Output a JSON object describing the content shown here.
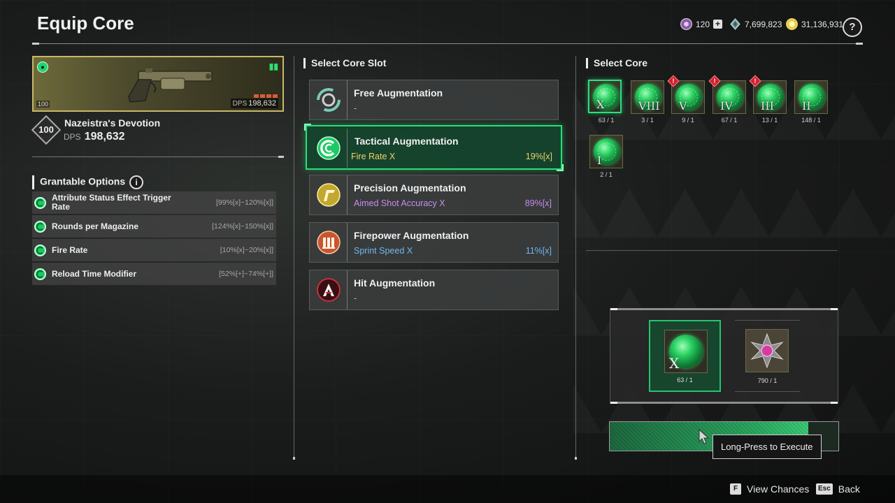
{
  "screen": {
    "title": "Equip Core"
  },
  "currencies": [
    {
      "icon": "shard-icon",
      "value": "120",
      "color": "#b48acb"
    },
    {
      "icon": "crystal-icon",
      "value": "7,699,823",
      "color": "#7fa6a6"
    },
    {
      "icon": "gold-coin-icon",
      "value": "31,136,931",
      "color": "#e6cf58"
    }
  ],
  "help": {
    "label": "?"
  },
  "weapon": {
    "level_badge": "100",
    "card_dps_label": "DPS",
    "card_dps": "198,632",
    "name": "Nazeistra's Devotion",
    "level": "100",
    "dps_label": "DPS",
    "dps": "198,632",
    "ammo_icon": "ammo-icon",
    "rarity_color": "#c8b86a"
  },
  "grantable": {
    "title": "Grantable Options",
    "info": "i",
    "options": [
      {
        "name": "Attribute Status Effect Trigger Rate",
        "range": "[99%[x]~120%[x]]"
      },
      {
        "name": "Rounds per Magazine",
        "range": "[124%[x]~150%[x]]"
      },
      {
        "name": "Fire Rate",
        "range": "[10%[x]~20%[x]]"
      },
      {
        "name": "Reload Time Modifier",
        "range": "[52%[+]~74%[+]]"
      }
    ]
  },
  "slots": {
    "title": "Select Core Slot",
    "items": [
      {
        "name": "Free Augmentation",
        "option": "-",
        "value": "",
        "icon": "free-augmentation-icon",
        "option_color": "#bdbdbd"
      },
      {
        "name": "Tactical Augmentation",
        "option": "Fire Rate X",
        "value": "19%[x]",
        "icon": "tactical-augmentation-icon",
        "option_color": "#e9d46a"
      },
      {
        "name": "Precision Augmentation",
        "option": "Aimed Shot Accuracy X",
        "value": "89%[x]",
        "icon": "precision-augmentation-icon",
        "option_color": "#c68cf2"
      },
      {
        "name": "Firepower Augmentation",
        "option": "Sprint Speed X",
        "value": "11%[x]",
        "icon": "firepower-augmentation-icon",
        "option_color": "#6fb7f0"
      },
      {
        "name": "Hit Augmentation",
        "option": "-",
        "value": "",
        "icon": "hit-augmentation-icon",
        "option_color": "#bdbdbd"
      }
    ]
  },
  "cores": {
    "title": "Select Core",
    "items": [
      {
        "roman": "X",
        "count": "63 / 1",
        "warn": false
      },
      {
        "roman": "VIII",
        "count": "3 / 1",
        "warn": false
      },
      {
        "roman": "V",
        "count": "9 / 1",
        "warn": true
      },
      {
        "roman": "IV",
        "count": "67 / 1",
        "warn": true
      },
      {
        "roman": "III",
        "count": "13 / 1",
        "warn": true
      },
      {
        "roman": "II",
        "count": "148 / 1",
        "warn": false
      },
      {
        "roman": "I",
        "count": "2 / 1",
        "warn": false
      }
    ],
    "warn_symbol": "!"
  },
  "preview": {
    "selected": {
      "roman": "X",
      "count": "63 / 1"
    },
    "material": {
      "count": "790 / 1",
      "icon": "catalyst-material-icon"
    }
  },
  "execute": {
    "progress": 0.87,
    "tooltip": "Long-Press to Execute"
  },
  "footer": {
    "view_key": "F",
    "view_label": "View Chances",
    "back_key": "Esc",
    "back_label": "Back"
  }
}
